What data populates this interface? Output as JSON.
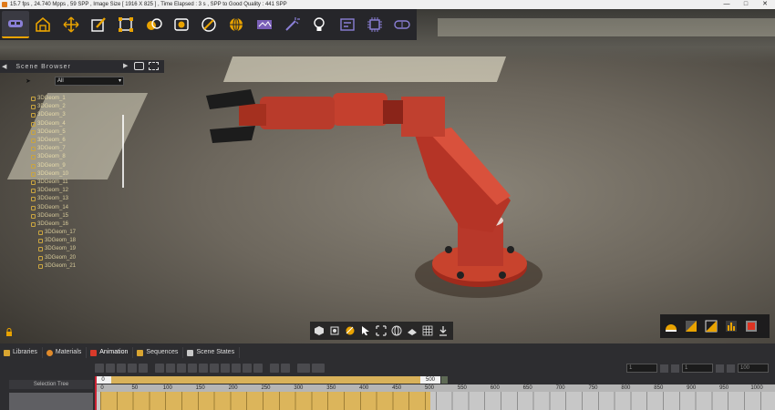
{
  "titlebar": {
    "text": "15.7 fps ,   24.740 Mpps ,   59 SPP     ,  Image Size [ 1916 X 825 ] ,  Time Elapsed : 3 s , SPP to Good Quality : 441 SPP",
    "min": "—",
    "max": "□",
    "close": "✕"
  },
  "toolbar": {
    "buttons": [
      "vr-headset-icon",
      "environment-icon",
      "move-icon",
      "paint-brush-icon",
      "select-region-icon",
      "materials-balls-icon",
      "camera-icon",
      "texture-icon",
      "sphere-icon",
      "panorama-360-icon",
      "magic-wand-icon",
      "light-bulb-icon",
      "layers-icon",
      "cpu-icon",
      "goggles-icon"
    ],
    "accent": "#e9a300"
  },
  "scene_browser": {
    "title": "Scene Browser",
    "filter": "All",
    "items": [
      "3DGeom_1",
      "3DGeom_2",
      "3DGeom_3",
      "3DGeom_4",
      "3DGeom_5",
      "3DGeom_6",
      "3DGeom_7",
      "3DGeom_8",
      "3DGeom_9",
      "3DGeom_10",
      "3DGeom_11",
      "3DGeom_12",
      "3DGeom_13",
      "3DGeom_14",
      "3DGeom_15",
      "3DGeom_16",
      "3DGeom_17",
      "3DGeom_18",
      "3DGeom_19",
      "3DGeom_20",
      "3DGeom_21"
    ]
  },
  "tabs": [
    "Libraries",
    "Materials",
    "Animation",
    "Sequences",
    "Scene States"
  ],
  "active_tab": "Animation",
  "selection_tree_label": "Selection Tree",
  "timeline": {
    "range_start": "0",
    "range_end": "500",
    "ruler": [
      "0",
      "50",
      "100",
      "150",
      "200",
      "250",
      "300",
      "350",
      "400",
      "450",
      "500",
      "550",
      "600",
      "650",
      "700",
      "750",
      "800",
      "850",
      "900",
      "950",
      "1000"
    ],
    "frame_fields": [
      "1",
      "1",
      "100"
    ],
    "active_color": "#dcb55b"
  }
}
